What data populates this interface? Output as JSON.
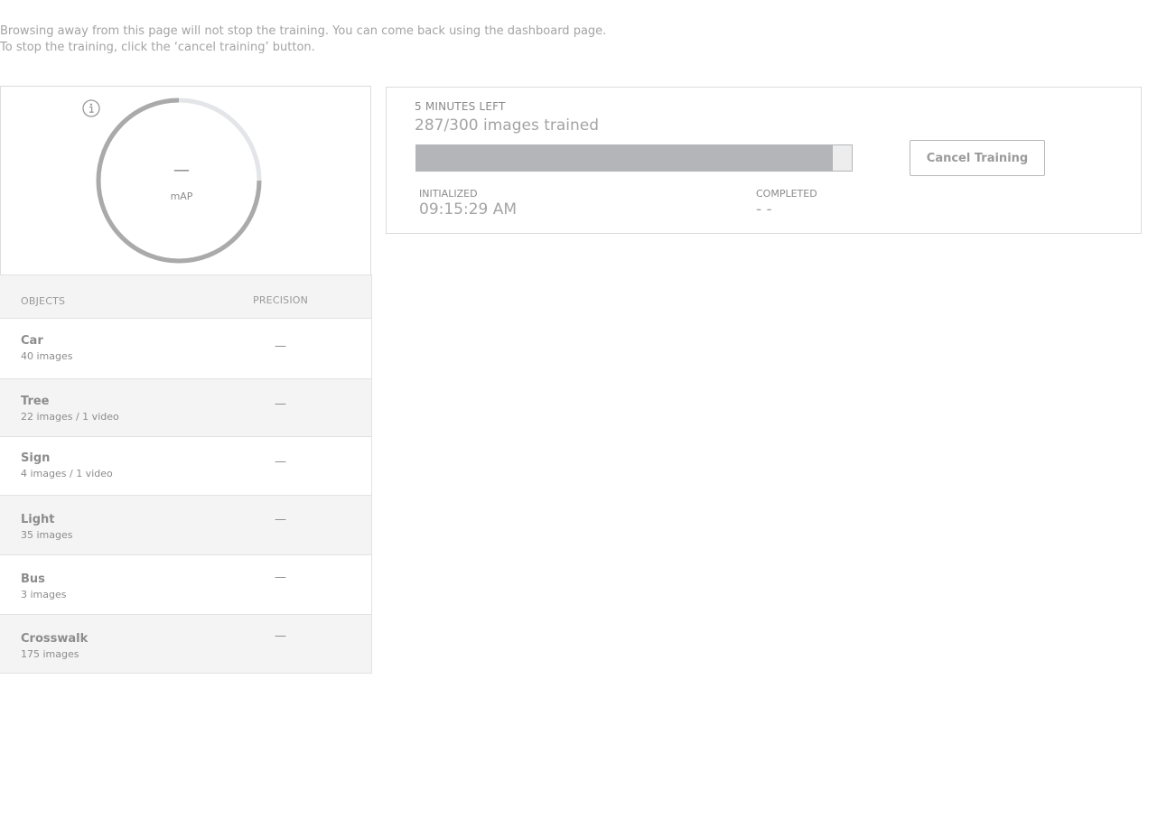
{
  "notice": {
    "line1": "Browsing away from this page will not stop the training. You can come back using the dashboard page.",
    "line2": "To stop the training, click the ‘cancel training’ button."
  },
  "map": {
    "value": "—",
    "label": "mAP",
    "info_icon": "info-icon"
  },
  "table": {
    "header_objects": "OBJECTS",
    "header_precision": "PRECISION",
    "rows": [
      {
        "name": "Car",
        "detail": "40 images",
        "precision": "—"
      },
      {
        "name": "Tree",
        "detail": "22 images / 1 video",
        "precision": "—"
      },
      {
        "name": "Sign",
        "detail": "4 images / 1 video",
        "precision": "—"
      },
      {
        "name": "Light",
        "detail": "35 images",
        "precision": "—"
      },
      {
        "name": "Bus",
        "detail": "3 images",
        "precision": "—"
      },
      {
        "name": "Crosswalk",
        "detail": "175 images",
        "precision": "—"
      }
    ]
  },
  "training": {
    "time_left": "5 MINUTES LEFT",
    "images_trained": "287/300 images trained",
    "progress_fraction": 0.9567,
    "initialized_label": "INITIALIZED",
    "initialized_value": "09:15:29 AM",
    "completed_label": "COMPLETED",
    "completed_value": "- -",
    "cancel_label": "Cancel Training"
  },
  "colors": {
    "progress_fill": "#b3b5b9",
    "progress_track": "#ededed",
    "ring_active": "#aaaaaa",
    "ring_inactive": "#e3e5e8"
  }
}
